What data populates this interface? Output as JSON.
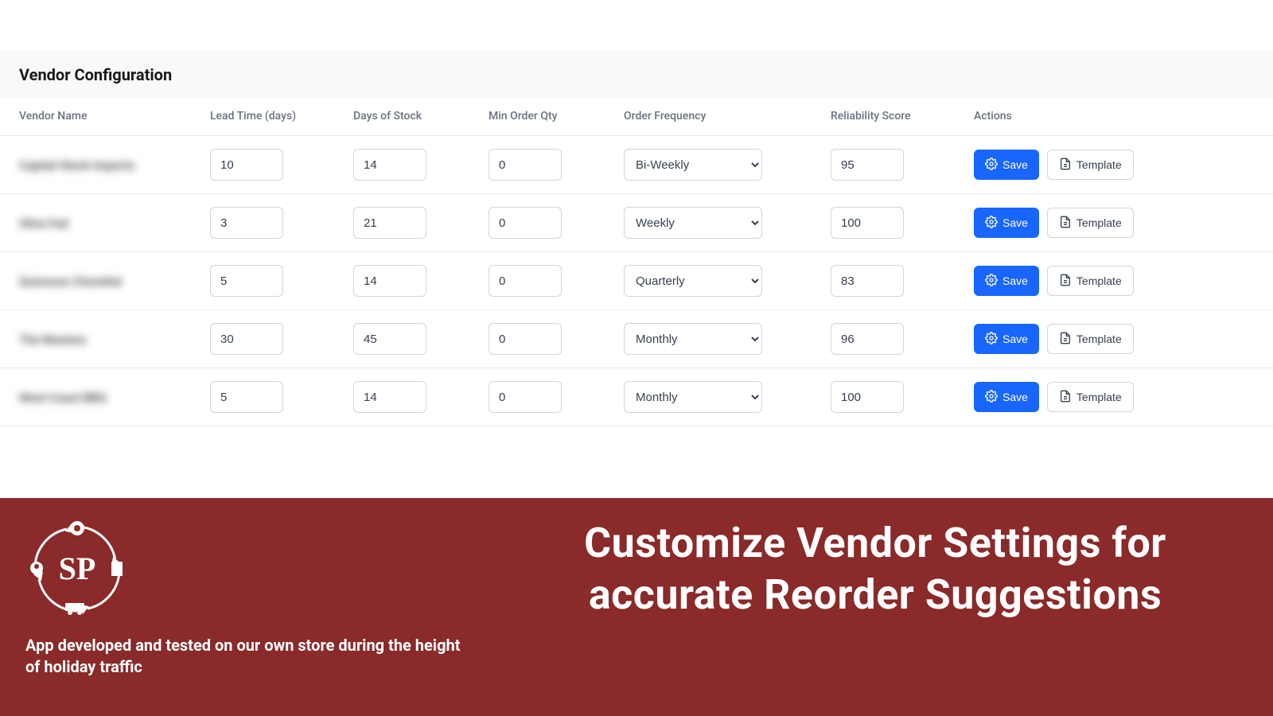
{
  "panel": {
    "title": "Vendor Configuration"
  },
  "columns": {
    "vendor": "Vendor Name",
    "lead": "Lead Time (days)",
    "days": "Days of Stock",
    "min": "Min Order Qty",
    "freq": "Order Frequency",
    "score": "Reliability Score",
    "actions": "Actions"
  },
  "buttons": {
    "save": "Save",
    "template": "Template"
  },
  "rows": [
    {
      "vendor": "Capital Stock Imports",
      "lead": "10",
      "days": "14",
      "min": "0",
      "freq": "Bi-Weekly",
      "score": "95"
    },
    {
      "vendor": "Olive Fed",
      "lead": "3",
      "days": "21",
      "min": "0",
      "freq": "Weekly",
      "score": "100"
    },
    {
      "vendor": "Quinnson Chorefed",
      "lead": "5",
      "days": "14",
      "min": "0",
      "freq": "Quarterly",
      "score": "83"
    },
    {
      "vendor": "The Mastery",
      "lead": "30",
      "days": "45",
      "min": "0",
      "freq": "Monthly",
      "score": "96"
    },
    {
      "vendor": "West Coast BBQ",
      "lead": "5",
      "days": "14",
      "min": "0",
      "freq": "Monthly",
      "score": "100"
    }
  ],
  "footer": {
    "tagline": "App developed and tested on our own store during the height of holiday traffic",
    "headline": "Customize Vendor Settings for accurate Reorder Suggestions",
    "logo_text": "SP"
  }
}
